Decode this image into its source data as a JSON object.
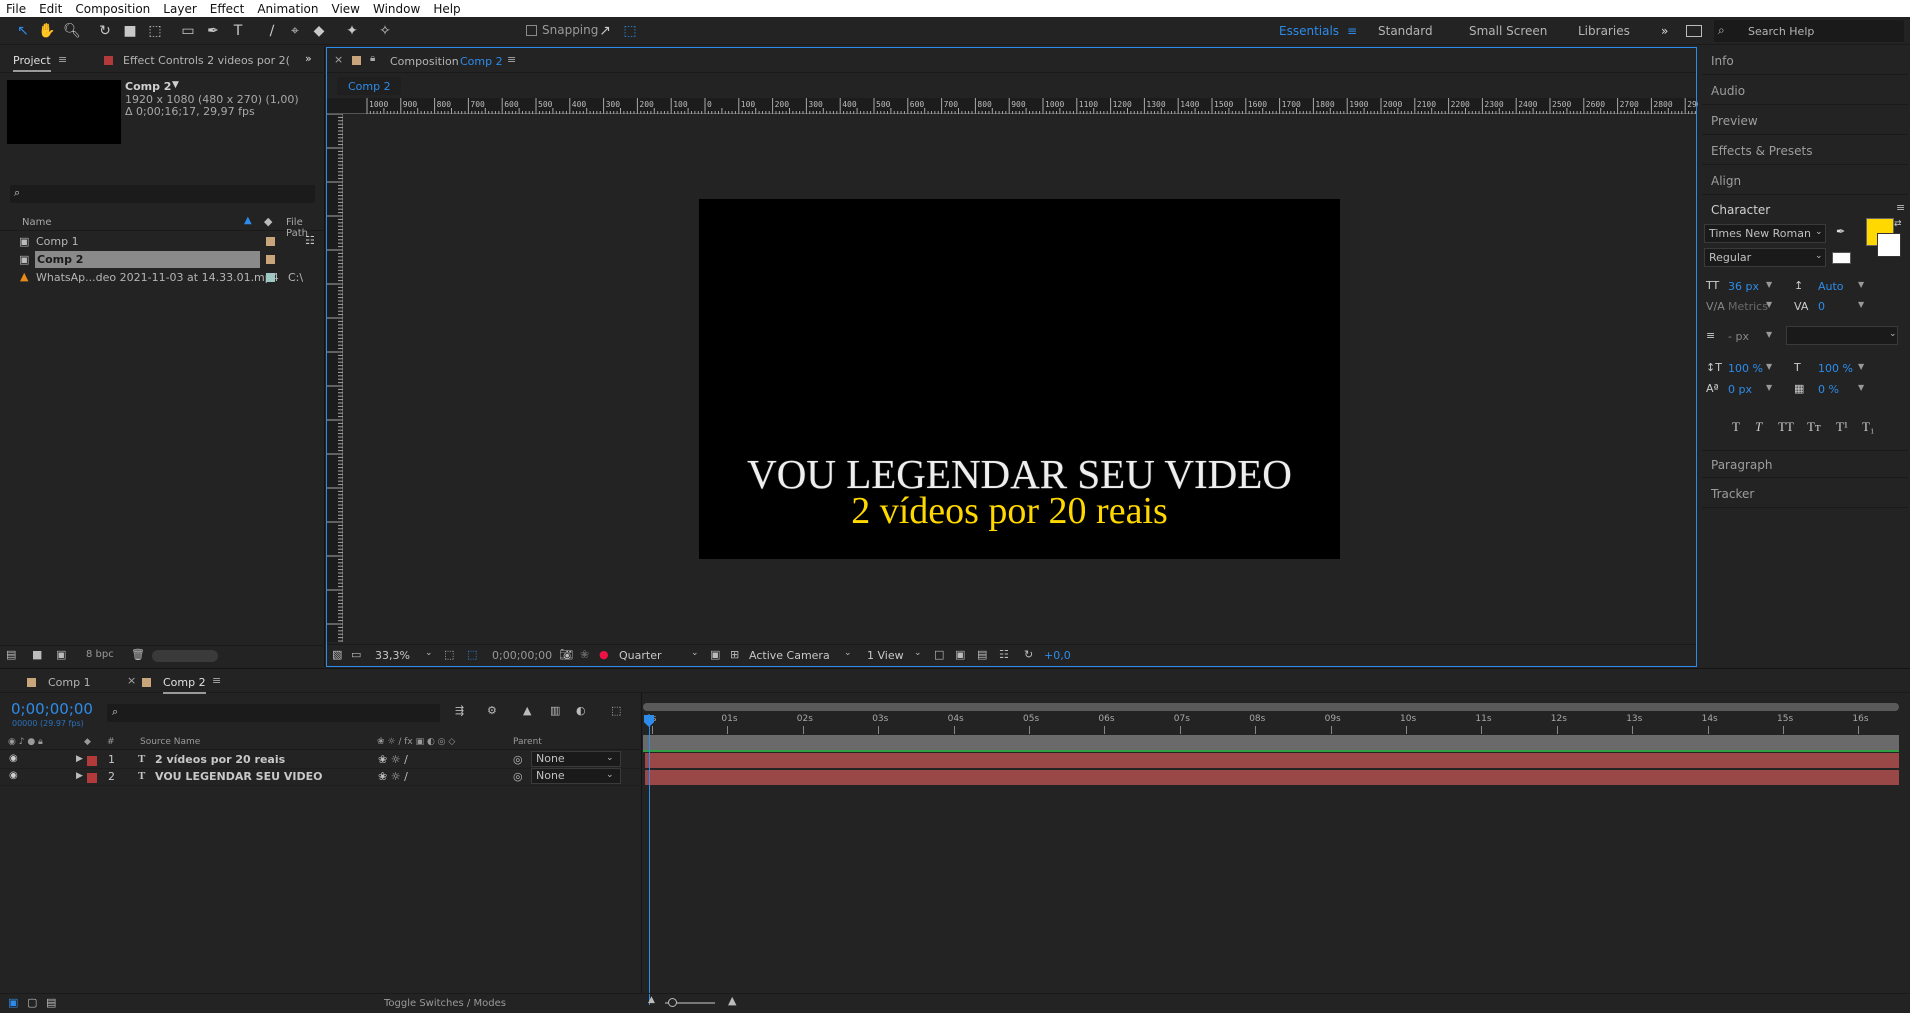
{
  "menu": [
    "File",
    "Edit",
    "Composition",
    "Layer",
    "Effect",
    "Animation",
    "View",
    "Window",
    "Help"
  ],
  "toolbar": {
    "snapping_label": "Snapping",
    "workspaces": [
      "Essentials",
      "Standard",
      "Small Screen",
      "Libraries"
    ],
    "active_workspace": "Essentials",
    "search_placeholder": "Search Help"
  },
  "project_panel": {
    "tab_label": "Project",
    "effect_controls_tab": "Effect Controls 2 videos por 2(",
    "comp_name": "Comp 2",
    "comp_info_line1": "1920 x 1080  (480 x 270) (1,00)",
    "comp_info_line2": "Δ 0;00;16;17, 29,97 fps",
    "col_name": "Name",
    "col_path": "File Path",
    "items": [
      {
        "name": "Comp 1",
        "path": ""
      },
      {
        "name": "Comp 2",
        "path": ""
      },
      {
        "name": "WhatsAp...deo 2021-11-03 at 14.33.01.mp4",
        "path": "C:\\"
      }
    ],
    "bpc": "8 bpc"
  },
  "composition_panel": {
    "tab_prefix": "Composition",
    "tab_comp": "Comp 2",
    "sub_tab": "Comp 2",
    "ruler_labels": [
      "1000",
      "900",
      "800",
      "700",
      "600",
      "500",
      "400",
      "300",
      "200",
      "100",
      "0",
      "100",
      "200",
      "300",
      "400",
      "500",
      "600",
      "700",
      "800",
      "900",
      "1000",
      "1100",
      "1200",
      "1300",
      "1400",
      "1500",
      "1600",
      "1700",
      "1800",
      "1900",
      "2000",
      "2100",
      "2200",
      "2300",
      "2400",
      "2500",
      "2600",
      "2700",
      "2800",
      "2900"
    ],
    "caption_line1": "VOU LEGENDAR SEU VIDEO",
    "caption_line2": "2 vídeos por 20 reais",
    "zoom": "33,3%",
    "timecode": "0;00;00;00",
    "resolution": "Quarter",
    "camera": "Active Camera",
    "views": "1 View",
    "exposure": "+0,0"
  },
  "right_panel": {
    "sections_top": [
      "Info",
      "Audio",
      "Preview",
      "Effects & Presets",
      "Align"
    ],
    "character_title": "Character",
    "font_family": "Times New Roman",
    "font_style": "Regular",
    "font_size": "36 px",
    "leading": "Auto",
    "kerning": "Metrics",
    "tracking": "0",
    "stroke_width": "- px",
    "vert_scale": "100 %",
    "horiz_scale": "100 %",
    "baseline_shift": "0 px",
    "tsume": "0 %",
    "fill_color": "#ffd800",
    "style_buttons": [
      "T",
      "T",
      "TT",
      "Tт",
      "T¹",
      "T₁"
    ],
    "sections_bottom": [
      "Paragraph",
      "Tracker"
    ]
  },
  "timeline": {
    "tabs": [
      "Comp 1",
      "Comp 2"
    ],
    "timecode": "0;00;00;00",
    "frames": "00000 (29.97 fps)",
    "col_source": "Source Name",
    "col_parent": "Parent",
    "layers": [
      {
        "num": "1",
        "name": "2 vídeos por 20 reais",
        "parent": "None"
      },
      {
        "num": "2",
        "name": "VOU LEGENDAR SEU VIDEO",
        "parent": "None"
      }
    ],
    "ticks": [
      "0s",
      "01s",
      "02s",
      "03s",
      "04s",
      "05s",
      "06s",
      "07s",
      "08s",
      "09s",
      "10s",
      "11s",
      "12s",
      "13s",
      "14s",
      "15s",
      "16s"
    ],
    "toggle_label": "Toggle Switches / Modes"
  }
}
